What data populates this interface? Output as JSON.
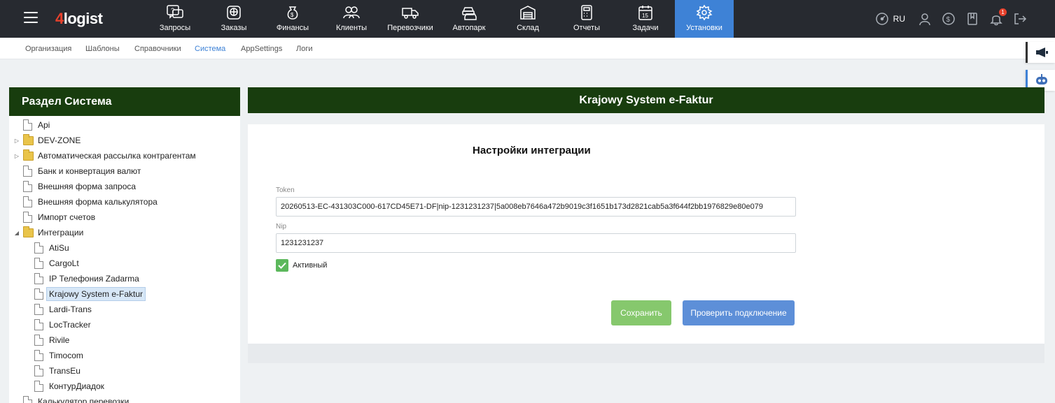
{
  "brand": {
    "logo_num": "4",
    "logo_text": "logist"
  },
  "nav": [
    {
      "label": "Запросы",
      "icon": "chat-question-icon"
    },
    {
      "label": "Заказы",
      "icon": "globe-box-icon"
    },
    {
      "label": "Финансы",
      "icon": "money-bag-icon"
    },
    {
      "label": "Клиенты",
      "icon": "users-icon"
    },
    {
      "label": "Перевозчики",
      "icon": "truck-icon"
    },
    {
      "label": "Автопарк",
      "icon": "cars-icon"
    },
    {
      "label": "Склад",
      "icon": "warehouse-icon"
    },
    {
      "label": "Отчеты",
      "icon": "calculator-icon"
    },
    {
      "label": "Задачи",
      "icon": "calendar-icon"
    },
    {
      "label": "Установки",
      "icon": "gear-icon"
    }
  ],
  "nav_active": "Установки",
  "topbar_tools": {
    "lang": "RU",
    "notification_count": "1"
  },
  "subnav": [
    {
      "label": "Организация"
    },
    {
      "label": "Шаблоны"
    },
    {
      "label": "Справочники"
    },
    {
      "label": "Система"
    },
    {
      "label": "AppSettings"
    },
    {
      "label": "Логи"
    }
  ],
  "subnav_active": "Система",
  "left_panel": {
    "title": "Раздел Система",
    "tree": [
      {
        "label": "Api",
        "type": "doc",
        "level": 0
      },
      {
        "label": "DEV-ZONE",
        "type": "folder",
        "level": 0,
        "arrow": "▷"
      },
      {
        "label": "Автоматическая рассылка контрагентам",
        "type": "folder",
        "level": 0,
        "arrow": "▷"
      },
      {
        "label": "Банк и конвертация валют",
        "type": "doc",
        "level": 0
      },
      {
        "label": "Внешняя форма запроса",
        "type": "doc",
        "level": 0
      },
      {
        "label": "Внешняя форма калькулятора",
        "type": "doc",
        "level": 0
      },
      {
        "label": "Импорт счетов",
        "type": "doc",
        "level": 0
      },
      {
        "label": "Интеграции",
        "type": "folder",
        "level": 0,
        "arrow": "◢"
      },
      {
        "label": "AtiSu",
        "type": "doc",
        "level": 1
      },
      {
        "label": "CargoLt",
        "type": "doc",
        "level": 1
      },
      {
        "label": "IP Телефония Zadarma",
        "type": "doc",
        "level": 1
      },
      {
        "label": "Krajowy System e-Faktur",
        "type": "doc",
        "level": 1,
        "selected": true
      },
      {
        "label": "Lardi-Trans",
        "type": "doc",
        "level": 1
      },
      {
        "label": "LocTracker",
        "type": "doc",
        "level": 1
      },
      {
        "label": "Rivile",
        "type": "doc",
        "level": 1
      },
      {
        "label": "Timocom",
        "type": "doc",
        "level": 1
      },
      {
        "label": "TransEu",
        "type": "doc",
        "level": 1
      },
      {
        "label": "КонтурДиадок",
        "type": "doc",
        "level": 1
      },
      {
        "label": "Калькулятор перевозки",
        "type": "doc",
        "level": 0
      }
    ]
  },
  "right_panel": {
    "title": "Krajowy System e-Faktur",
    "form_title": "Настройки интеграции",
    "token_label": "Token",
    "token_value": "20260513-EC-431303C000-617CD45E71-DF|nip-1231231237|5a008eb7646a472b9019c3f1651b173d2821cab5a3f644f2bb1976829e80e079",
    "nip_label": "Nip",
    "nip_value": "1231231237",
    "active_label": "Активный",
    "active_checked": true,
    "save_label": "Сохранить",
    "check_label": "Проверить подключение"
  },
  "colors": {
    "topbar": "#272a30",
    "accent": "#3e82d6",
    "panel_header": "#183d0e",
    "save_button": "#86c86d",
    "check_button": "#5d8fd8",
    "checkbox": "#5cb85c"
  }
}
